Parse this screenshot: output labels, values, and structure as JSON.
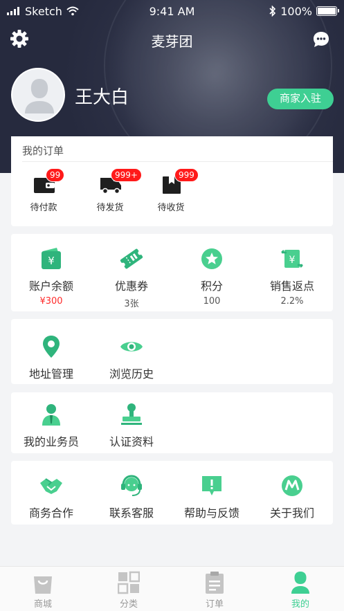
{
  "status_bar": {
    "carrier": "Sketch",
    "time": "9:41 AM",
    "battery": "100%"
  },
  "nav": {
    "title": "麦芽团"
  },
  "profile": {
    "name": "王大白",
    "merchant_button": "商家入驻"
  },
  "orders": {
    "title": "我的订单",
    "items": [
      {
        "label": "待付款",
        "badge": "99",
        "icon": "wallet-icon"
      },
      {
        "label": "待发货",
        "badge": "999+",
        "icon": "truck-icon"
      },
      {
        "label": "待收货",
        "badge": "999",
        "icon": "package-icon"
      }
    ]
  },
  "assets": [
    {
      "label": "账户余额",
      "value": "¥300",
      "icon": "wallet-yuan-icon"
    },
    {
      "label": "优惠券",
      "value": "3张",
      "icon": "ticket-icon"
    },
    {
      "label": "积分",
      "value": "100",
      "icon": "star-icon"
    },
    {
      "label": "销售返点",
      "value": "2.2%",
      "icon": "rebate-icon"
    }
  ],
  "services1": [
    {
      "label": "地址管理",
      "icon": "location-pin-icon"
    },
    {
      "label": "浏览历史",
      "icon": "eye-icon"
    }
  ],
  "services2": [
    {
      "label": "我的业务员",
      "icon": "salesperson-icon"
    },
    {
      "label": "认证资料",
      "icon": "certification-stamp-icon"
    }
  ],
  "services3": [
    {
      "label": "商务合作",
      "icon": "handshake-icon"
    },
    {
      "label": "联系客服",
      "icon": "headset-icon"
    },
    {
      "label": "帮助与反馈",
      "icon": "feedback-icon"
    },
    {
      "label": "关于我们",
      "icon": "about-logo-icon"
    }
  ],
  "tabbar": [
    {
      "label": "商城",
      "icon": "shop-bag-icon"
    },
    {
      "label": "分类",
      "icon": "category-grid-icon"
    },
    {
      "label": "订单",
      "icon": "order-clipboard-icon"
    },
    {
      "label": "我的",
      "icon": "profile-person-icon",
      "active": true
    }
  ],
  "colors": {
    "accent": "#3ecf93",
    "badge": "#ff1a1a",
    "header": "#2c3045"
  }
}
